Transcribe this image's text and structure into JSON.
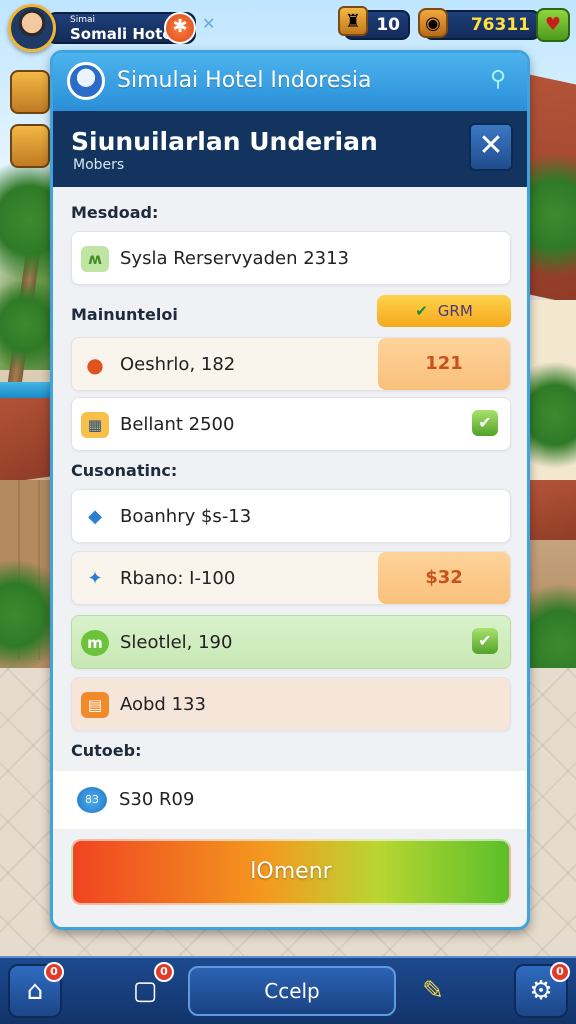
{
  "top_bar": {
    "profile_small": "Simai",
    "profile_name": "Somali Hotel",
    "level": "10",
    "coins": "76311"
  },
  "panel": {
    "header_title": "Simulai Hotel Indoresia",
    "sub_title": "Siunuilarlan Underian",
    "sub_subtitle": "Mobers",
    "section1_label": "Mesdoad:",
    "row1_text": "Sysla Rerservyaden 2313",
    "section2_label": "Mainunteloi",
    "pill_text": "GRM",
    "row2_text": "Oeshrlo, 182",
    "row2_tag": "121",
    "row3_text": "Bellant 2500",
    "section3_label": "Cusonatinc:",
    "row4_text": "Boanhry $s-13",
    "row5_text": "Rbano: I-100",
    "row5_tag": "$32",
    "row6_text": "Sleotlel, 190",
    "row7_text": "Aobd 133",
    "section4_label": "Cutoeb:",
    "result_text": "S30 R09",
    "result_icon": "83",
    "action_label": "lOmenr"
  },
  "bottom_bar": {
    "home_badge": "0",
    "chat_badge": "0",
    "center_label": "Ccelp",
    "settings_badge": "0"
  },
  "colors": {
    "panel_border": "#3ea4e0",
    "sub_header": "#13345f",
    "action_start": "#f04420",
    "action_end": "#5bbf2a"
  }
}
